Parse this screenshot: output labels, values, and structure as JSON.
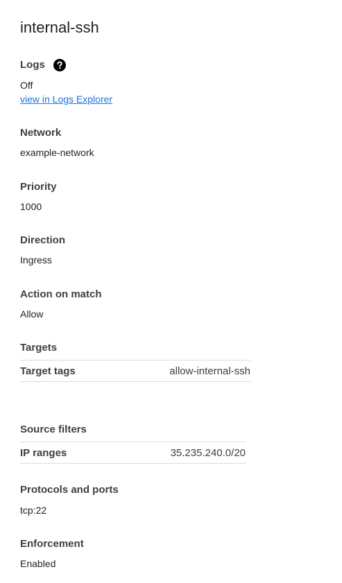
{
  "title": "internal-ssh",
  "logs": {
    "label": "Logs",
    "value": "Off",
    "link_text": "view in Logs Explorer",
    "help_icon": "help-circle-icon"
  },
  "network": {
    "label": "Network",
    "value": "example-network"
  },
  "priority": {
    "label": "Priority",
    "value": "1000"
  },
  "direction": {
    "label": "Direction",
    "value": "Ingress"
  },
  "action": {
    "label": "Action on match",
    "value": "Allow"
  },
  "targets": {
    "label": "Targets",
    "row_key": "Target tags",
    "row_value": "allow-internal-ssh"
  },
  "source_filters": {
    "label": "Source filters",
    "row_key": "IP ranges",
    "row_value": "35.235.240.0/20"
  },
  "protocols": {
    "label": "Protocols and ports",
    "value": "tcp:22"
  },
  "enforcement": {
    "label": "Enforcement",
    "value": "Enabled"
  },
  "colors": {
    "link": "#1a73e8",
    "text": "#202124",
    "divider": "#dadce0"
  }
}
